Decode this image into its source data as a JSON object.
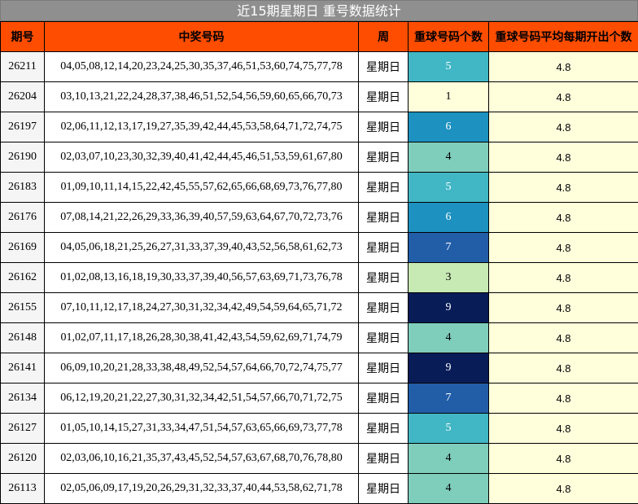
{
  "title": "近15期星期日 重号数据统计",
  "headers": [
    "期号",
    "中奖号码",
    "周",
    "重球号码个数",
    "重球号码平均每期开出个数"
  ],
  "colors": {
    "header_bg": "#ff4d00",
    "title_bg": "#8f8f8f",
    "avg_bg": "#ffffdc",
    "count_scale": {
      "1": "#ffffdc",
      "3": "#c7e9b4",
      "4": "#7fcdbb",
      "5": "#41b6c4",
      "6": "#1d91c0",
      "7": "#225ea8",
      "9": "#081d58"
    }
  },
  "rows": [
    {
      "period": "26211",
      "numbers": "04,05,08,12,14,20,23,24,25,30,35,37,46,51,53,60,74,75,77,78",
      "week": "星期日",
      "count": "5",
      "avg": "4.8"
    },
    {
      "period": "26204",
      "numbers": "03,10,13,21,22,24,28,37,38,46,51,52,54,56,59,60,65,66,70,73",
      "week": "星期日",
      "count": "1",
      "avg": "4.8"
    },
    {
      "period": "26197",
      "numbers": "02,06,11,12,13,17,19,27,35,39,42,44,45,53,58,64,71,72,74,75",
      "week": "星期日",
      "count": "6",
      "avg": "4.8"
    },
    {
      "period": "26190",
      "numbers": "02,03,07,10,23,30,32,39,40,41,42,44,45,46,51,53,59,61,67,80",
      "week": "星期日",
      "count": "4",
      "avg": "4.8"
    },
    {
      "period": "26183",
      "numbers": "01,09,10,11,14,15,22,42,45,55,57,62,65,66,68,69,73,76,77,80",
      "week": "星期日",
      "count": "5",
      "avg": "4.8"
    },
    {
      "period": "26176",
      "numbers": "07,08,14,21,22,26,29,33,36,39,40,57,59,63,64,67,70,72,73,76",
      "week": "星期日",
      "count": "6",
      "avg": "4.8"
    },
    {
      "period": "26169",
      "numbers": "04,05,06,18,21,25,26,27,31,33,37,39,40,43,52,56,58,61,62,73",
      "week": "星期日",
      "count": "7",
      "avg": "4.8"
    },
    {
      "period": "26162",
      "numbers": "01,02,08,13,16,18,19,30,33,37,39,40,56,57,63,69,71,73,76,78",
      "week": "星期日",
      "count": "3",
      "avg": "4.8"
    },
    {
      "period": "26155",
      "numbers": "07,10,11,12,17,18,24,27,30,31,32,34,42,49,54,59,64,65,71,72",
      "week": "星期日",
      "count": "9",
      "avg": "4.8"
    },
    {
      "period": "26148",
      "numbers": "01,02,07,11,17,18,26,28,30,38,41,42,43,54,59,62,69,71,74,79",
      "week": "星期日",
      "count": "4",
      "avg": "4.8"
    },
    {
      "period": "26141",
      "numbers": "06,09,10,20,21,28,33,38,48,49,52,54,57,64,66,70,72,74,75,77",
      "week": "星期日",
      "count": "9",
      "avg": "4.8"
    },
    {
      "period": "26134",
      "numbers": "06,12,19,20,21,22,27,30,31,32,34,42,51,54,57,66,70,71,72,75",
      "week": "星期日",
      "count": "7",
      "avg": "4.8"
    },
    {
      "period": "26127",
      "numbers": "01,05,10,14,15,27,31,33,34,47,51,54,57,63,65,66,69,73,77,78",
      "week": "星期日",
      "count": "5",
      "avg": "4.8"
    },
    {
      "period": "26120",
      "numbers": "02,03,06,10,16,21,35,37,43,45,52,54,57,63,67,68,70,76,78,80",
      "week": "星期日",
      "count": "4",
      "avg": "4.8"
    },
    {
      "period": "26113",
      "numbers": "02,05,06,09,17,19,20,26,29,31,32,33,37,40,44,53,58,62,71,78",
      "week": "星期日",
      "count": "4",
      "avg": "4.8"
    }
  ]
}
